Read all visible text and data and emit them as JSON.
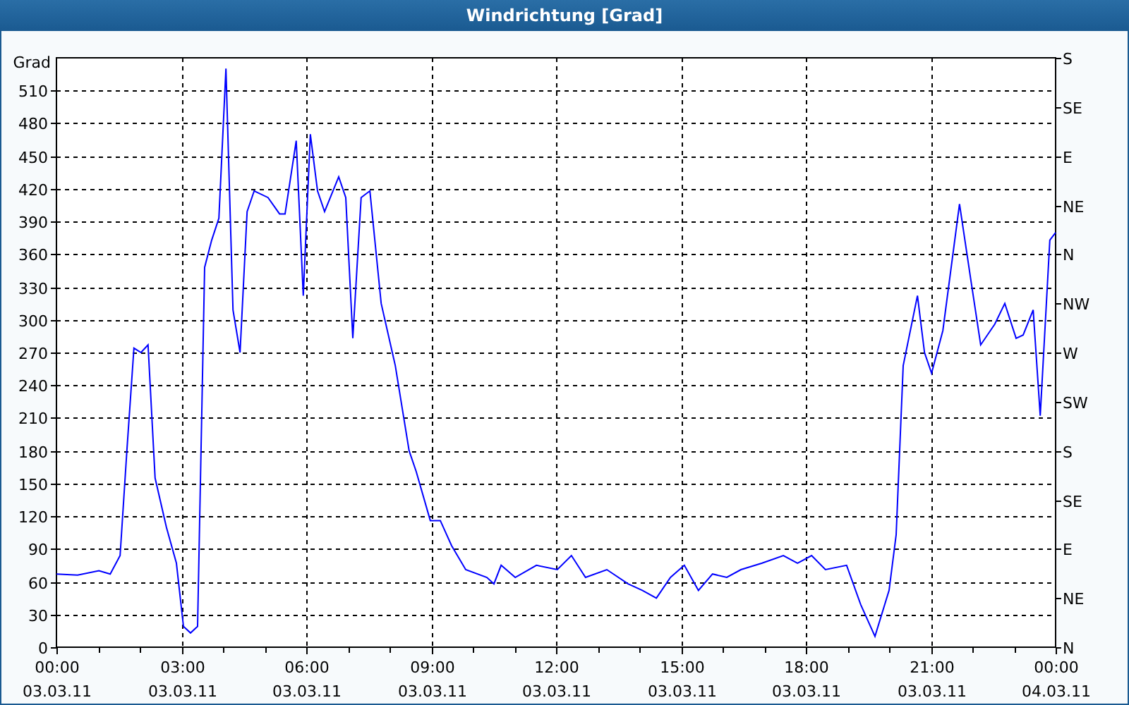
{
  "window": {
    "title": "Windrichtung [Grad]"
  },
  "chart": {
    "chart_data": {
      "type": "line",
      "ylabel": "Grad",
      "xlim": [
        0,
        24
      ],
      "ylim": [
        0,
        540
      ],
      "x": [
        0,
        0.51,
        1.02,
        1.29,
        1.53,
        1.69,
        1.86,
        2.03,
        2.2,
        2.37,
        2.64,
        2.88,
        3.05,
        3.22,
        3.39,
        3.56,
        3.73,
        3.9,
        4.07,
        4.24,
        4.41,
        4.58,
        4.75,
        5.08,
        5.36,
        5.49,
        5.76,
        5.93,
        6.1,
        6.27,
        6.44,
        6.78,
        6.95,
        7.12,
        7.32,
        7.53,
        7.8,
        8.14,
        8.47,
        8.64,
        8.98,
        9.22,
        9.49,
        9.83,
        10.34,
        10.51,
        10.68,
        11.02,
        11.53,
        12.03,
        12.37,
        12.71,
        13.22,
        13.73,
        14.07,
        14.41,
        14.75,
        15.08,
        15.42,
        15.76,
        16.1,
        16.44,
        16.95,
        17.46,
        17.8,
        18.14,
        18.47,
        18.98,
        19.32,
        19.66,
        20.0,
        20.17,
        20.34,
        20.68,
        20.85,
        21.02,
        21.29,
        21.69,
        21.97,
        22.2,
        22.54,
        22.78,
        23.05,
        23.22,
        23.46,
        23.63,
        23.86,
        24.0
      ],
      "grid": true,
      "series": [
        {
          "color": "#0000ff",
          "values": [
            67,
            66,
            70,
            67,
            84,
            180,
            274,
            270,
            277,
            155,
            110,
            77,
            19,
            13,
            19,
            348,
            373,
            393,
            530,
            309,
            270,
            399,
            418,
            412,
            397,
            397,
            464,
            322,
            470,
            418,
            399,
            431,
            412,
            283,
            412,
            418,
            315,
            258,
            180,
            161,
            116,
            116,
            93,
            71,
            64,
            58,
            75,
            64,
            75,
            71,
            84,
            64,
            71,
            58,
            52,
            45,
            64,
            75,
            52,
            67,
            64,
            71,
            77,
            84,
            77,
            84,
            71,
            75,
            39,
            10,
            52,
            103,
            258,
            322,
            270,
            251,
            290,
            406,
            335,
            277,
            296,
            315,
            283,
            286,
            309,
            212,
            373,
            380
          ]
        }
      ],
      "xticks": [
        {
          "value": 0,
          "label": "00:00"
        },
        {
          "value": 3,
          "label": "03:00"
        },
        {
          "value": 6,
          "label": "06:00"
        },
        {
          "value": 9,
          "label": "09:00"
        },
        {
          "value": 12,
          "label": "12:00"
        },
        {
          "value": 15,
          "label": "15:00"
        },
        {
          "value": 18,
          "label": "18:00"
        },
        {
          "value": 21,
          "label": "21:00"
        },
        {
          "value": 24,
          "label": "00:00"
        }
      ],
      "yticks": [
        0,
        30,
        60,
        90,
        120,
        150,
        180,
        210,
        240,
        270,
        300,
        330,
        360,
        390,
        420,
        450,
        480,
        510
      ]
    },
    "date_labels": [
      "03.03.11",
      "03.03.11",
      "03.03.11",
      "03.03.11",
      "03.03.11",
      "03.03.11",
      "03.03.11",
      "03.03.11",
      "04.03.11"
    ],
    "right_axis": [
      "S",
      "SE",
      "E",
      "NE",
      "N",
      "NW",
      "W",
      "SW",
      "S",
      "SE",
      "E",
      "NE",
      "N"
    ]
  }
}
